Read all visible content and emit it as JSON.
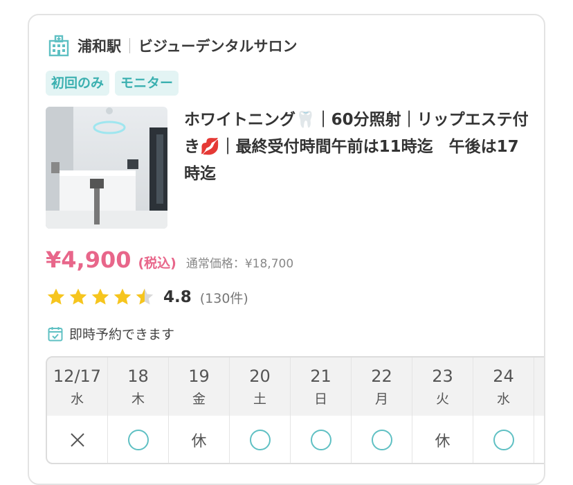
{
  "clinic": {
    "station": "浦和駅",
    "name": "ビジューデンタルサロン",
    "icon": "building-icon"
  },
  "tags": [
    "初回のみ",
    "モニター"
  ],
  "plan_title": "ホワイトニング🦷｜60分照射｜リップエステ付き💋｜最終受付時間午前は11時迄　午後は17時迄",
  "price": {
    "amount": "¥4,900",
    "tax": "(税込)",
    "regular": "通常価格：¥18,700"
  },
  "rating": {
    "value": "4.8",
    "count": "(130件)",
    "stars": 4.5,
    "star_color": "#f6c51e"
  },
  "instant_booking": "即時予約できます",
  "calendar": [
    {
      "date": "12/17",
      "weekday": "水",
      "status": "×"
    },
    {
      "date": "18",
      "weekday": "木",
      "status": "○"
    },
    {
      "date": "19",
      "weekday": "金",
      "status": "休"
    },
    {
      "date": "20",
      "weekday": "土",
      "status": "○"
    },
    {
      "date": "21",
      "weekday": "日",
      "status": "○"
    },
    {
      "date": "22",
      "weekday": "月",
      "status": "○"
    },
    {
      "date": "23",
      "weekday": "火",
      "status": "休"
    },
    {
      "date": "24",
      "weekday": "水",
      "status": "○"
    },
    {
      "date": "",
      "weekday": "",
      "status": ""
    }
  ],
  "colors": {
    "accent_teal": "#5fc0c3",
    "price_pink": "#e8668a",
    "tag_bg": "#e3f4f4"
  }
}
